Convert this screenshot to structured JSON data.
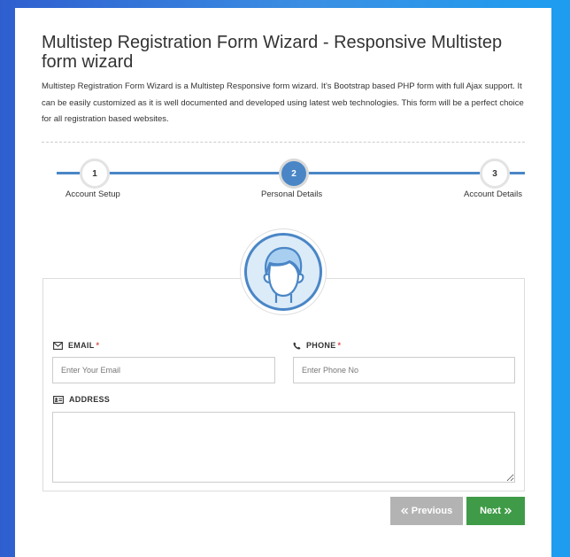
{
  "page": {
    "title": "Multistep Registration Form Wizard - Responsive Multistep form wizard",
    "description": "Multistep Registration Form Wizard is a Multistep Responsive form wizard. It's Bootstrap based PHP form with full Ajax support. It can be easily customized as it is well documented and developed using latest web technologies. This form will be a perfect choice for all registration based websites."
  },
  "wizard": {
    "current_step": 2,
    "steps": [
      {
        "number": "1",
        "label": "Account Setup"
      },
      {
        "number": "2",
        "label": "Personal Details"
      },
      {
        "number": "3",
        "label": "Account Details"
      }
    ]
  },
  "form": {
    "email": {
      "label": "EMAIL",
      "required_mark": "*",
      "placeholder": "Enter Your Email",
      "value": "",
      "icon": "envelope-icon"
    },
    "phone": {
      "label": "PHONE",
      "required_mark": "*",
      "placeholder": "Enter Phone No",
      "value": "",
      "icon": "phone-icon"
    },
    "address": {
      "label": "ADDRESS",
      "value": "",
      "icon": "id-card-icon"
    }
  },
  "buttons": {
    "previous": "Previous",
    "next": "Next"
  },
  "colors": {
    "accent": "#4a86c6",
    "next_button": "#3f9b47",
    "previous_button": "#b3b3b3",
    "required": "#d9534f"
  }
}
